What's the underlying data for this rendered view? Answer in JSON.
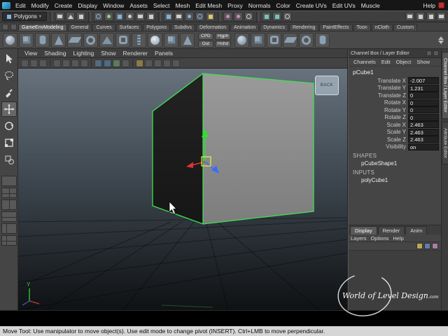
{
  "menubar": {
    "items": [
      "Edit",
      "Modify",
      "Create",
      "Display",
      "Window",
      "Assets",
      "Select",
      "Mesh",
      "Edit Mesh",
      "Proxy",
      "Normals",
      "Color",
      "Create UVs",
      "Edit UVs",
      "Muscle",
      "Help"
    ]
  },
  "status_line": {
    "menu_set": "Polygons"
  },
  "shelf": {
    "tabs": [
      "GameEnvModeling",
      "General",
      "Curves",
      "Surfaces",
      "Polygons",
      "Subdivs",
      "Deformation",
      "Animation",
      "Dynamics",
      "Rendering",
      "PaintEffects",
      "Toon",
      "nCloth",
      "Custom"
    ],
    "chips": [
      "CPD",
      "Out",
      "Hgph",
      "Hshd"
    ]
  },
  "viewport": {
    "menus": [
      "View",
      "Shading",
      "Lighting",
      "Show",
      "Renderer",
      "Panels"
    ],
    "viewcube_label": "BACK",
    "axis_label": "Y"
  },
  "channel_box": {
    "title": "Channel Box / Layer Editor",
    "menus": [
      "Channels",
      "Edit",
      "Object",
      "Show"
    ],
    "object_name": "pCube1",
    "attributes": [
      {
        "label": "Translate X",
        "value": "-2.007"
      },
      {
        "label": "Translate Y",
        "value": "1.231"
      },
      {
        "label": "Translate Z",
        "value": "0"
      },
      {
        "label": "Rotate X",
        "value": "0"
      },
      {
        "label": "Rotate Y",
        "value": "0"
      },
      {
        "label": "Rotate Z",
        "value": "0"
      },
      {
        "label": "Scale X",
        "value": "2.463"
      },
      {
        "label": "Scale Y",
        "value": "2.463"
      },
      {
        "label": "Scale Z",
        "value": "2.463"
      },
      {
        "label": "Visibility",
        "value": "on"
      }
    ],
    "shapes_label": "SHAPES",
    "shape_name": "pCubeShape1",
    "inputs_label": "INPUTS",
    "input_name": "polyCube1"
  },
  "layer_editor": {
    "tabs": [
      "Display",
      "Render",
      "Anim"
    ],
    "menus": [
      "Layers",
      "Options",
      "Help"
    ]
  },
  "side_tabs": {
    "channel_box": "Channel Box / Layer Editor",
    "attribute_editor": "Attribute Editor"
  },
  "watermark": {
    "text": "World of Level Design",
    "suffix": ".com"
  },
  "help_line": {
    "text": "Move Tool: Use manipulator to move object(s). Use edit mode to change pivot (INSERT). Ctrl+LMB to move perpendicular."
  }
}
